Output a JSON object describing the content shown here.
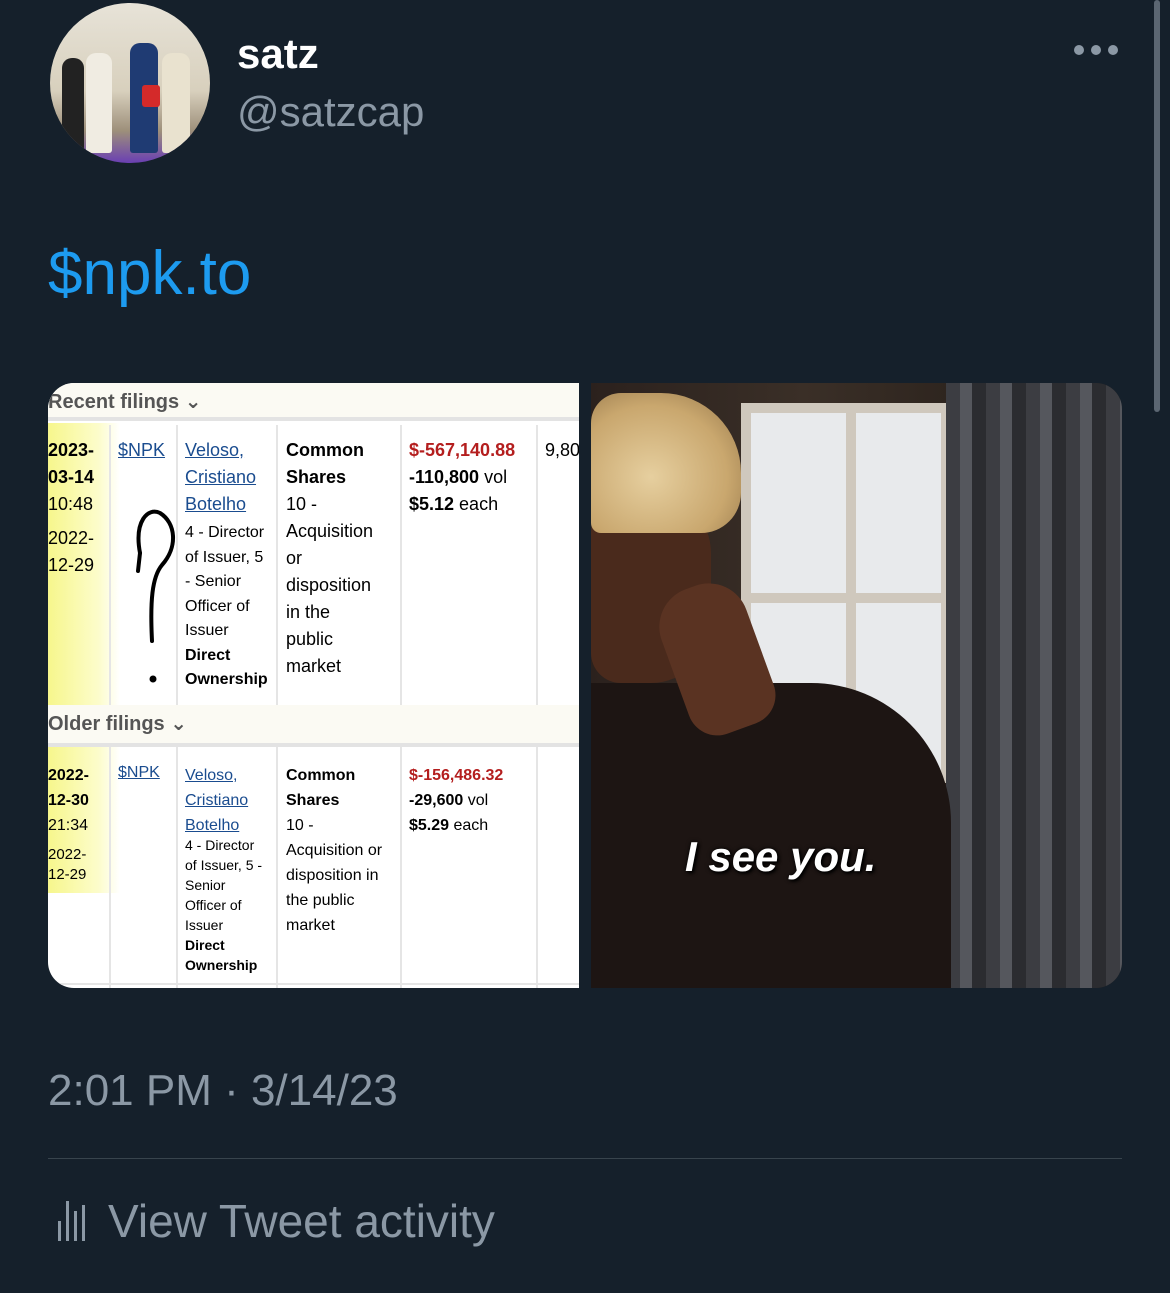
{
  "author": {
    "display_name": "satz",
    "handle": "@satzcap"
  },
  "tweet": {
    "text": "$npk.to",
    "timestamp": "2:01 PM · 3/14/23"
  },
  "media_left": {
    "sections": [
      {
        "title": "Recent filings ⌄",
        "row": {
          "date_a": "2023-",
          "date_b": "03-14",
          "time": "10:48",
          "date2_a": "2022-",
          "date2_b": "12-29",
          "ticker": "$NPK",
          "name": [
            "Veloso,",
            "Cristiano",
            "Botelho"
          ],
          "role": [
            "4 - Director",
            "of Issuer, 5",
            "- Senior",
            "Officer of",
            "Issuer"
          ],
          "ownership": [
            "Direct",
            "Ownership"
          ],
          "security": [
            "Common",
            "Shares"
          ],
          "nature": [
            "10 -",
            "Acquisition",
            "or",
            "disposition",
            "in the",
            "public",
            "market"
          ],
          "value": "$-567,140.88",
          "volume_num": "-110,800",
          "volume_unit": " vol",
          "price_num": "$5.12",
          "price_unit": " each",
          "extra": "9,80"
        }
      },
      {
        "title": "Older filings ⌄",
        "row": {
          "date_a": "2022-",
          "date_b": "12-30",
          "time": "21:34",
          "date2_a": "2022-",
          "date2_b": "12-29",
          "ticker": "$NPK",
          "name": [
            "Veloso,",
            "Cristiano",
            "Botelho"
          ],
          "role": [
            "4 - Director",
            "of Issuer, 5 -",
            "Senior",
            "Officer of",
            "Issuer"
          ],
          "ownership": [
            "Direct",
            "Ownership"
          ],
          "security": [
            "Common",
            "Shares"
          ],
          "nature": [
            "10 -",
            "Acquisition or",
            "disposition in",
            "the public",
            "market"
          ],
          "value": "$-156,486.32",
          "volume_num": "-29,600",
          "volume_unit": " vol",
          "price_num": "$5.29",
          "price_unit": " each"
        }
      }
    ]
  },
  "media_right": {
    "caption": "I see you."
  },
  "actions": {
    "view_activity": "View Tweet activity"
  },
  "icons": {
    "more": "more-horizontal-icon",
    "activity": "bar-chart-icon"
  },
  "colors": {
    "background": "#15202b",
    "link": "#1d9bf0",
    "muted": "#8b98a5"
  }
}
